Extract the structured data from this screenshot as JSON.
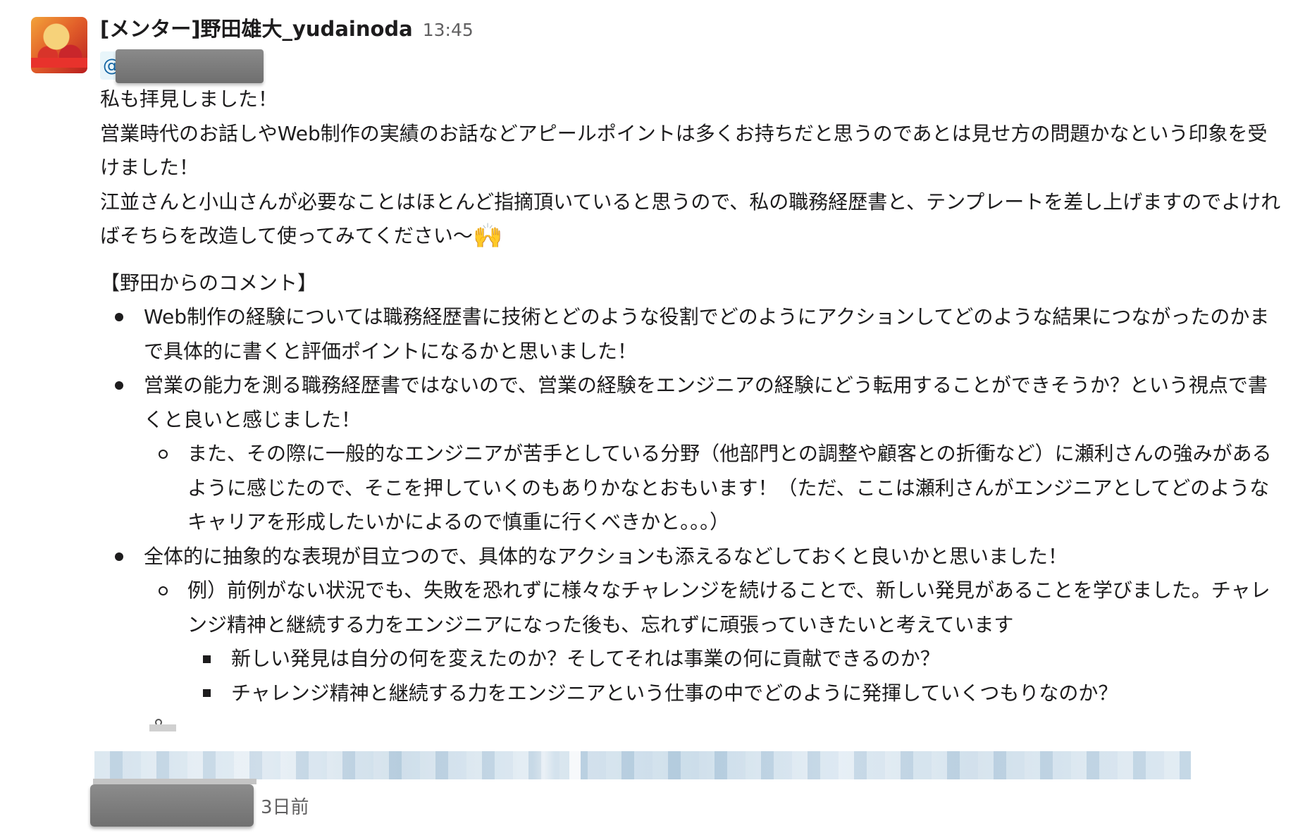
{
  "message": {
    "sender": "[メンター]野田雄大_yudainoda",
    "timestamp": "13:45",
    "mention_prefix": "@",
    "paragraphs": [
      "私も拝見しました！",
      "営業時代のお話しやWeb制作の実績のお話などアピールポイントは多くお持ちだと思うのであとは見せ方の問題かなという印象を受けました！",
      "江並さんと小山さんが必要なことはほとんど指摘頂いていると思うので、私の職務経歴書と、テンプレートを差し上げますのでよければそちらを改造して使ってみてください〜"
    ],
    "emoji": "🙌",
    "comment_heading": "【野田からのコメント】",
    "items": [
      "Web制作の経験については職務経歴書に技術とどのような役割でどのようにアクションしてどのような結果につながったのかまで具体的に書くと評価ポイントになるかと思いました！",
      "営業の能力を測る職務経歴書ではないので、営業の経験をエンジニアの経験にどう転用することができそうか？という視点で書くと良いと感じました！",
      "また、その際に一般的なエンジニアが苦手としている分野（他部門との調整や顧客との折衝など）に瀬利さんの強みがあるように感じたので、そこを押していくのもありかなとおもいます！（ただ、ここは瀬利さんがエンジニアとしてどのようなキャリアを形成したいかによるので慎重に行くべきかと。。。）",
      "全体的に抽象的な表現が目立つので、具体的なアクションも添えるなどしておくと良いかと思いました！",
      "例）前例がない状況でも、失敗を恐れずに様々なチャレンジを続けることで、新しい発見があることを学びました。チャレンジ精神と継続する力をエンジニアになった後も、忘れずに頑張っていきたいと考えています",
      "新しい発見は自分の何を変えたのか？そしてそれは事業の何に貢献できるのか？",
      "チャレンジ精神と継続する力をエンジニアという仕事の中でどのように発揮していくつもりなのか？"
    ]
  },
  "attachment": {
    "time_ago": "3日前"
  }
}
